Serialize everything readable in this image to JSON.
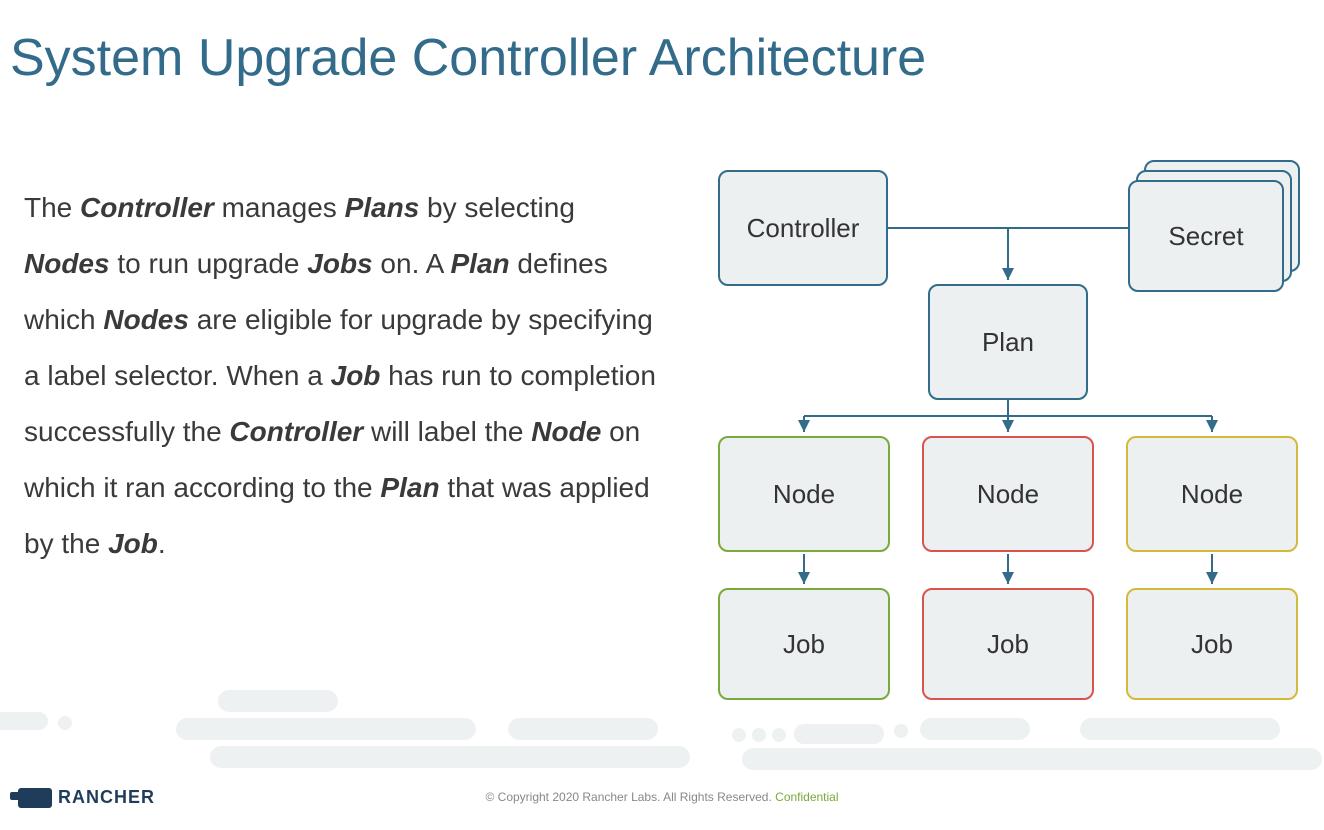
{
  "title": "System Upgrade Controller Architecture",
  "paragraph": {
    "parts": [
      {
        "t": "The "
      },
      {
        "t": "Controller",
        "b": true
      },
      {
        "t": " manages "
      },
      {
        "t": "Plans",
        "b": true
      },
      {
        "t": " by selecting "
      },
      {
        "t": "Nodes",
        "b": true
      },
      {
        "t": " to run upgrade "
      },
      {
        "t": "Jobs",
        "b": true
      },
      {
        "t": " on. A "
      },
      {
        "t": "Plan",
        "b": true
      },
      {
        "t": " defines which "
      },
      {
        "t": "Nodes",
        "b": true
      },
      {
        "t": " are eligible for upgrade by specifying a label selector. When a "
      },
      {
        "t": "Job",
        "b": true
      },
      {
        "t": " has run to completion successfully the "
      },
      {
        "t": "Controller",
        "b": true
      },
      {
        "t": " will label the "
      },
      {
        "t": "Node",
        "b": true
      },
      {
        "t": " on which it ran according to the "
      },
      {
        "t": "Plan",
        "b": true
      },
      {
        "t": " that was applied by the "
      },
      {
        "t": "Job",
        "b": true
      },
      {
        "t": "."
      }
    ]
  },
  "diagram": {
    "controller": "Controller",
    "secret": "Secret",
    "plan": "Plan",
    "nodes": [
      "Node",
      "Node",
      "Node"
    ],
    "jobs": [
      "Job",
      "Job",
      "Job"
    ]
  },
  "footer": {
    "brand": "RANCHER",
    "copyright": "© Copyright 2020 Rancher Labs. All Rights Reserved. ",
    "confidential": "Confidential"
  }
}
